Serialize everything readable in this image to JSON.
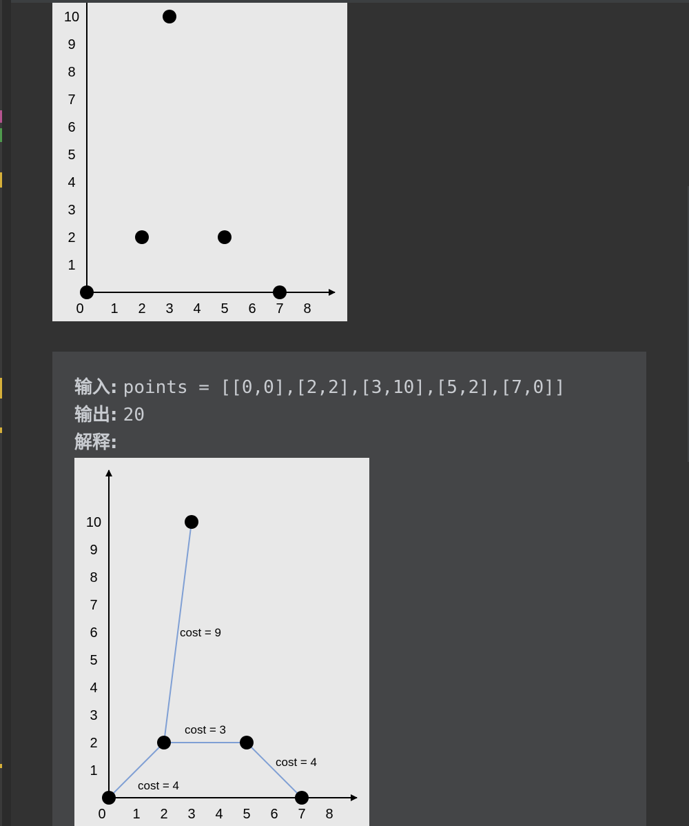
{
  "editor": {
    "accent_colors": {
      "gutter_pink": "#b5548f",
      "gutter_green": "#4f9a4d",
      "gutter_yellow": "#d6b03a"
    }
  },
  "figure_top": {
    "chart_data": {
      "type": "scatter",
      "points": [
        [
          0,
          0
        ],
        [
          2,
          2
        ],
        [
          3,
          10
        ],
        [
          5,
          2
        ],
        [
          7,
          0
        ]
      ],
      "x_ticks": [
        "0",
        "1",
        "2",
        "3",
        "4",
        "5",
        "6",
        "7",
        "8"
      ],
      "y_ticks": [
        "1",
        "2",
        "3",
        "4",
        "5",
        "6",
        "7",
        "8",
        "9",
        "10"
      ],
      "xlim": [
        0,
        8
      ],
      "ylim": [
        0,
        10
      ],
      "grid": false
    }
  },
  "example": {
    "input_label": "输入:",
    "input_value": "points = [[0,0],[2,2],[3,10],[5,2],[7,0]]",
    "output_label": "输出:",
    "output_value": "20",
    "explanation_label": "解释:"
  },
  "figure_bottom": {
    "chart_data": {
      "type": "scatter",
      "points": [
        [
          0,
          0
        ],
        [
          2,
          2
        ],
        [
          3,
          10
        ],
        [
          5,
          2
        ],
        [
          7,
          0
        ]
      ],
      "edges": [
        {
          "from": [
            0,
            0
          ],
          "to": [
            2,
            2
          ],
          "label": "cost = 4"
        },
        {
          "from": [
            2,
            2
          ],
          "to": [
            3,
            10
          ],
          "label": "cost = 9"
        },
        {
          "from": [
            2,
            2
          ],
          "to": [
            5,
            2
          ],
          "label": "cost = 3"
        },
        {
          "from": [
            5,
            2
          ],
          "to": [
            7,
            0
          ],
          "label": "cost = 4"
        }
      ],
      "edge_color": "#7f9fd4",
      "x_ticks": [
        "0",
        "1",
        "2",
        "3",
        "4",
        "5",
        "6",
        "7",
        "8"
      ],
      "y_ticks": [
        "1",
        "2",
        "3",
        "4",
        "5",
        "6",
        "7",
        "8",
        "9",
        "10"
      ],
      "xlim": [
        0,
        8
      ],
      "ylim": [
        0,
        10
      ],
      "grid": false
    }
  }
}
